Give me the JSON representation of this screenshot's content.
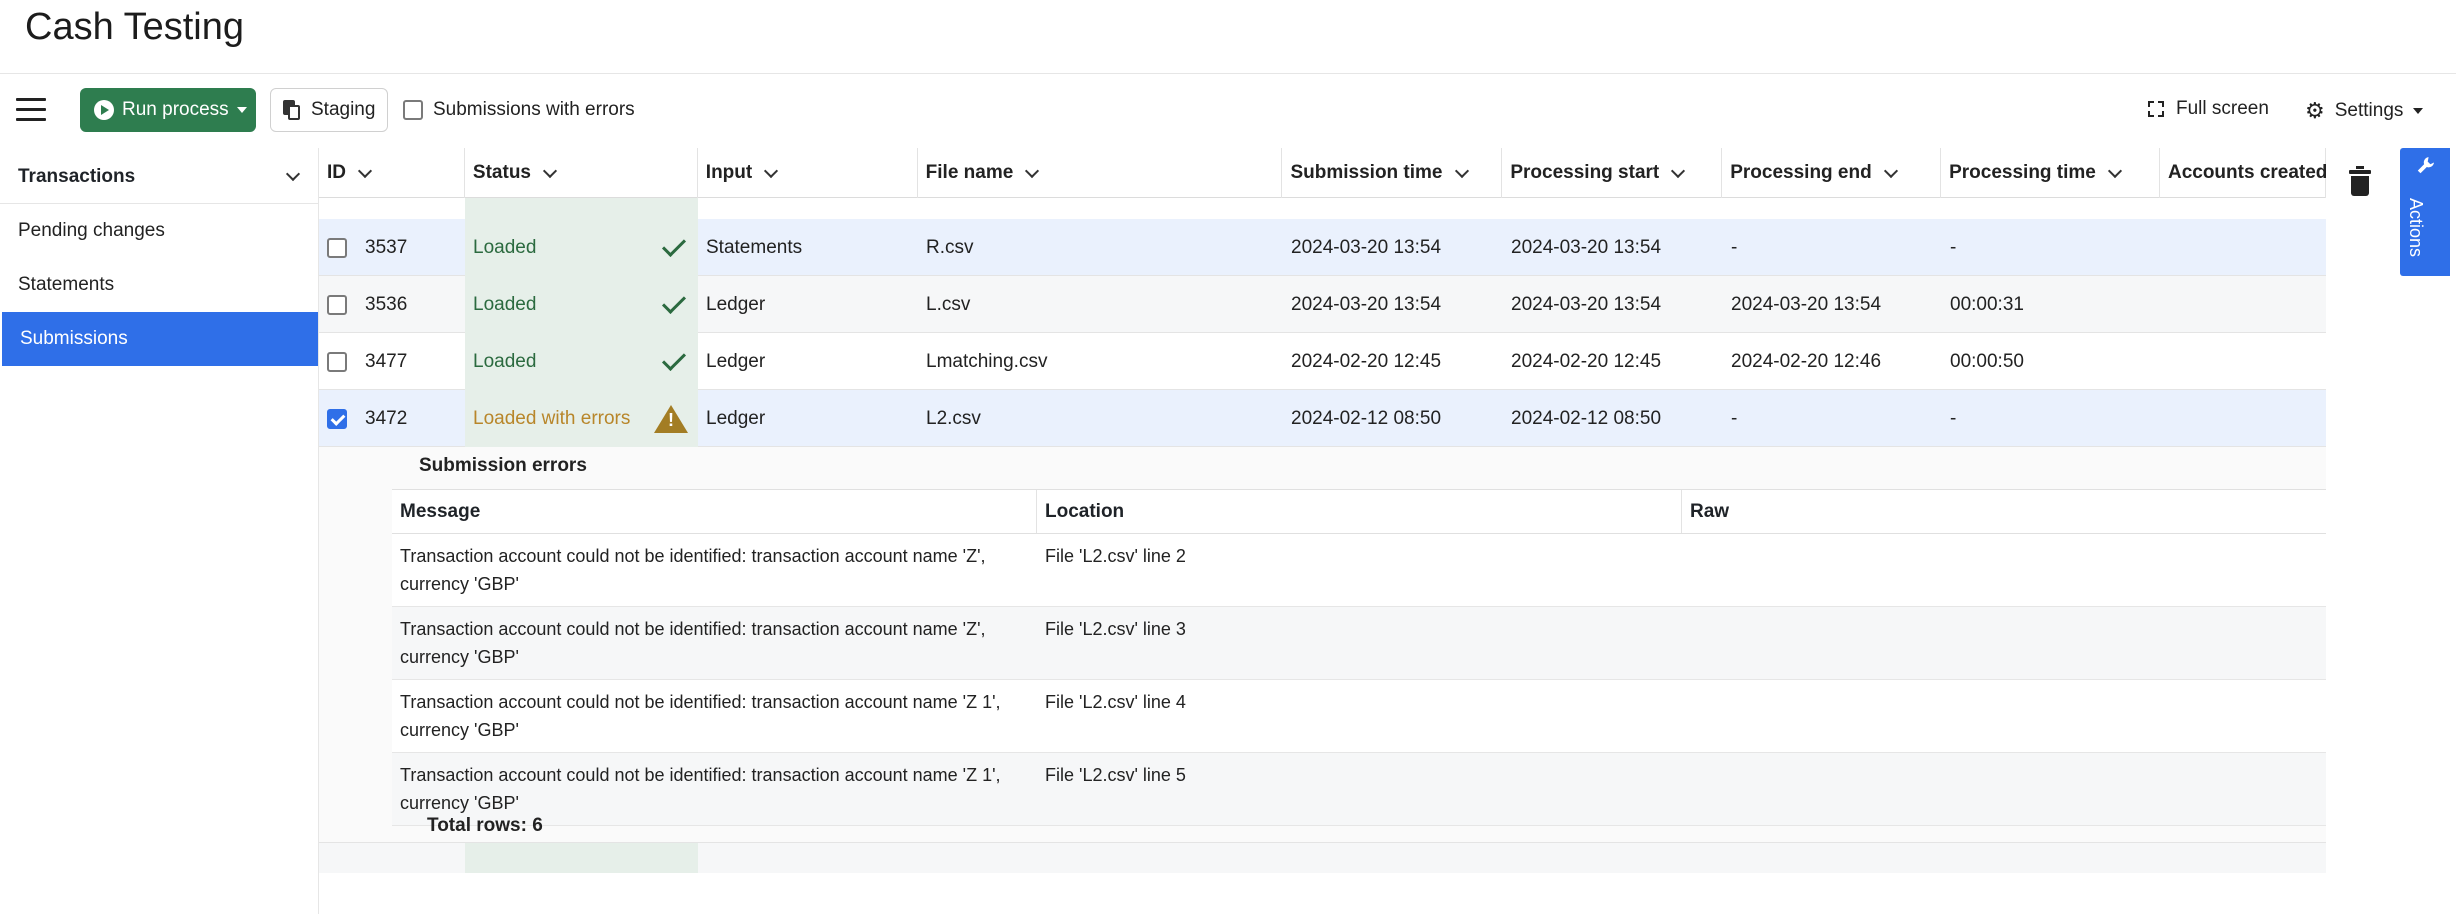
{
  "app": {
    "title": "Cash Testing"
  },
  "toolbar": {
    "run_label": "Run process",
    "staging_label": "Staging",
    "errors_filter_label": "Submissions with errors",
    "fullscreen_label": "Full screen",
    "settings_label": "Settings"
  },
  "sidebar": {
    "header": "Transactions",
    "items": [
      {
        "label": "Pending changes"
      },
      {
        "label": "Statements"
      },
      {
        "label": "Submissions",
        "active": true
      }
    ]
  },
  "grid": {
    "columns": [
      "ID",
      "Status",
      "Input",
      "File name",
      "Submission time",
      "Processing start",
      "Processing end",
      "Processing time",
      "Accounts created"
    ],
    "rows": [
      {
        "id": "3537",
        "status": "Loaded",
        "input": "Statements",
        "file": "R.csv",
        "submitted": "2024-03-20 13:54",
        "start": "2024-03-20 13:54",
        "end": "-",
        "duration": "-",
        "checked": false
      },
      {
        "id": "3536",
        "status": "Loaded",
        "input": "Ledger",
        "file": "L.csv",
        "submitted": "2024-03-20 13:54",
        "start": "2024-03-20 13:54",
        "end": "2024-03-20 13:54",
        "duration": "00:00:31",
        "checked": false
      },
      {
        "id": "3477",
        "status": "Loaded",
        "input": "Ledger",
        "file": "Lmatching.csv",
        "submitted": "2024-02-20 12:45",
        "start": "2024-02-20 12:45",
        "end": "2024-02-20 12:46",
        "duration": "00:00:50",
        "checked": false
      },
      {
        "id": "3472",
        "status": "Loaded with errors",
        "input": "Ledger",
        "file": "L2.csv",
        "submitted": "2024-02-12 08:50",
        "start": "2024-02-12 08:50",
        "end": "-",
        "duration": "-",
        "checked": true
      }
    ]
  },
  "submission_errors": {
    "title": "Submission errors",
    "columns": [
      "Message",
      "Location",
      "Raw"
    ],
    "rows": [
      {
        "message": "Transaction account could not be identified: transaction account name 'Z', currency 'GBP'",
        "location": "File 'L2.csv' line 2",
        "raw": ""
      },
      {
        "message": "Transaction account could not be identified: transaction account name 'Z', currency 'GBP'",
        "location": "File 'L2.csv' line 3",
        "raw": ""
      },
      {
        "message": "Transaction account could not be identified: transaction account name 'Z 1', currency 'GBP'",
        "location": "File 'L2.csv' line 4",
        "raw": ""
      },
      {
        "message": "Transaction account could not be identified: transaction account name 'Z 1', currency 'GBP'",
        "location": "File 'L2.csv' line 5",
        "raw": ""
      }
    ],
    "total": "Total rows: 6"
  },
  "actions_tab": {
    "label": "Actions"
  },
  "colors": {
    "accent": "#2f6fe8",
    "run_button": "#2e7d4f",
    "loaded": "#2b6a3f",
    "warning": "#a37d24"
  }
}
